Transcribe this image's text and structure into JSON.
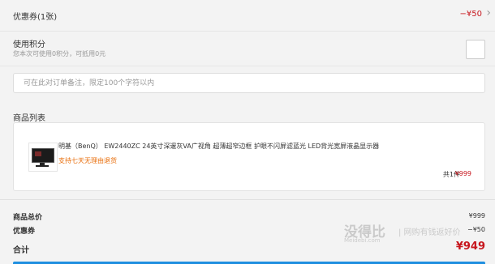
{
  "coupon": {
    "label": "优惠券(1张)",
    "value": "−¥50",
    "chevron": "›"
  },
  "points": {
    "title": "使用积分",
    "hint": "您本次可使用0积分，可抵用0元"
  },
  "remark": {
    "placeholder": "可在此对订单备注，限定100个字符以内"
  },
  "products": {
    "title": "商品列表",
    "item": {
      "name": "明基（BenQ） EW2440ZC 24英寸深邃灰VA广视角 超薄超窄边框 护眼不闪屏滤蓝光 LED背光宽屏液晶显示器",
      "tag": "支持七天无理由退货",
      "qty": "共1件",
      "price": "¥999"
    }
  },
  "summary": {
    "goods_total_label": "商品总价",
    "goods_total_value": "¥999",
    "coupon_label": "优惠券",
    "coupon_value": "−¥50",
    "total_label": "合计",
    "total_value": "¥949"
  },
  "watermark": {
    "main": "没得比",
    "sub": "| 网购有钱返好价",
    "url": "Meidebi.com"
  },
  "colors": {
    "accent": "#c7161d",
    "orange": "#e86d0a",
    "blue": "#1f8fe0",
    "background": "#f3f3f3"
  }
}
